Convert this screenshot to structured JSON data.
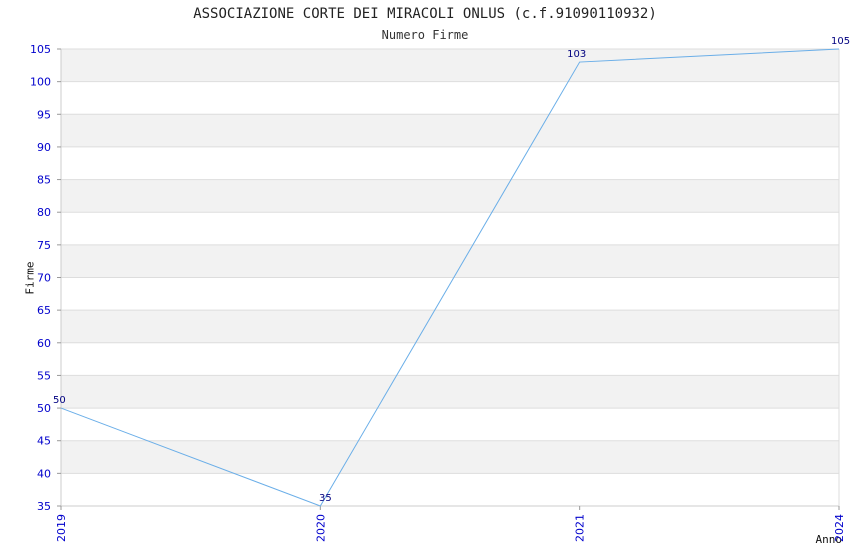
{
  "chart_data": {
    "type": "line",
    "title": "ASSOCIAZIONE CORTE DEI MIRACOLI ONLUS (c.f.91090110932)",
    "subtitle": "Numero Firme",
    "xlabel": "Anno",
    "ylabel": "Firme",
    "categories": [
      "2019",
      "2020",
      "2021",
      "2024"
    ],
    "series": [
      {
        "values": [
          50,
          35,
          103,
          105
        ]
      }
    ],
    "ylim": [
      35,
      105
    ],
    "yticks": [
      35,
      40,
      45,
      50,
      55,
      60,
      65,
      70,
      75,
      80,
      85,
      90,
      95,
      100,
      105
    ],
    "grid": "horizontal alternating bands",
    "colors": {
      "line": "#6aaee8",
      "band": "#f2f2f2",
      "tick_text": "#0000cc",
      "data_label": "#000080",
      "grid_line": "#dddddd"
    }
  }
}
